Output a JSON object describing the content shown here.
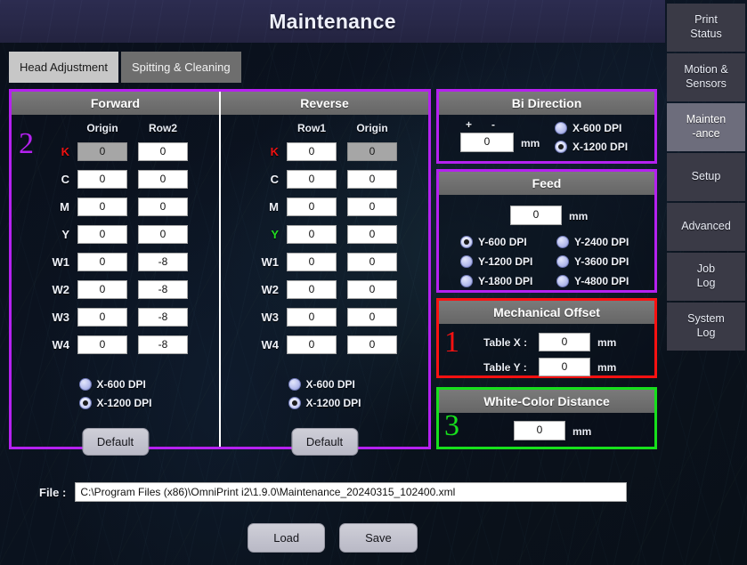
{
  "header": {
    "title": "Maintenance"
  },
  "tabs": [
    {
      "label": "Head Adjustment",
      "active": true
    },
    {
      "label": "Spitting & Cleaning",
      "active": false
    }
  ],
  "annotations": {
    "one": "1",
    "two": "2",
    "three": "3"
  },
  "colors": {
    "accent_magenta": "#b521f0",
    "accent_red": "#fb1111",
    "accent_green": "#17e01c",
    "label_k": "#ee1111",
    "label_y_reverse": "#22dd22",
    "label_default": "#eef1f8",
    "titlebar": "#2a2a4a"
  },
  "head_adjustment": {
    "forward": {
      "title": "Forward",
      "columns": [
        "Origin",
        "Row2"
      ],
      "rows": [
        {
          "label": "K",
          "values": [
            "0",
            "0"
          ],
          "disabled": [
            true,
            false
          ]
        },
        {
          "label": "C",
          "values": [
            "0",
            "0"
          ],
          "disabled": [
            false,
            false
          ]
        },
        {
          "label": "M",
          "values": [
            "0",
            "0"
          ],
          "disabled": [
            false,
            false
          ]
        },
        {
          "label": "Y",
          "values": [
            "0",
            "0"
          ],
          "disabled": [
            false,
            false
          ]
        },
        {
          "label": "W1",
          "values": [
            "0",
            "-8"
          ],
          "disabled": [
            false,
            false
          ]
        },
        {
          "label": "W2",
          "values": [
            "0",
            "-8"
          ],
          "disabled": [
            false,
            false
          ]
        },
        {
          "label": "W3",
          "values": [
            "0",
            "-8"
          ],
          "disabled": [
            false,
            false
          ]
        },
        {
          "label": "W4",
          "values": [
            "0",
            "-8"
          ],
          "disabled": [
            false,
            false
          ]
        }
      ],
      "dpi_options": [
        {
          "label": "X-600 DPI",
          "selected": false
        },
        {
          "label": "X-1200 DPI",
          "selected": true
        }
      ],
      "default_button": "Default"
    },
    "reverse": {
      "title": "Reverse",
      "columns": [
        "Row1",
        "Origin"
      ],
      "rows": [
        {
          "label": "K",
          "values": [
            "0",
            "0"
          ],
          "disabled": [
            false,
            true
          ]
        },
        {
          "label": "C",
          "values": [
            "0",
            "0"
          ],
          "disabled": [
            false,
            false
          ]
        },
        {
          "label": "M",
          "values": [
            "0",
            "0"
          ],
          "disabled": [
            false,
            false
          ]
        },
        {
          "label": "Y",
          "values": [
            "0",
            "0"
          ],
          "disabled": [
            false,
            false
          ]
        },
        {
          "label": "W1",
          "values": [
            "0",
            "0"
          ],
          "disabled": [
            false,
            false
          ]
        },
        {
          "label": "W2",
          "values": [
            "0",
            "0"
          ],
          "disabled": [
            false,
            false
          ]
        },
        {
          "label": "W3",
          "values": [
            "0",
            "0"
          ],
          "disabled": [
            false,
            false
          ]
        },
        {
          "label": "W4",
          "values": [
            "0",
            "0"
          ],
          "disabled": [
            false,
            false
          ]
        }
      ],
      "dpi_options": [
        {
          "label": "X-600 DPI",
          "selected": false
        },
        {
          "label": "X-1200 DPI",
          "selected": true
        }
      ],
      "default_button": "Default"
    }
  },
  "bi_direction": {
    "title": "Bi Direction",
    "plus": "+",
    "minus": "-",
    "value": "0",
    "unit": "mm",
    "dpi_options": [
      {
        "label": "X-600 DPI",
        "selected": false
      },
      {
        "label": "X-1200 DPI",
        "selected": true
      }
    ]
  },
  "feed": {
    "title": "Feed",
    "value": "0",
    "unit": "mm",
    "dpi_options": [
      {
        "label": "Y-600 DPI",
        "selected": true
      },
      {
        "label": "Y-2400 DPI",
        "selected": false
      },
      {
        "label": "Y-1200 DPI",
        "selected": false
      },
      {
        "label": "Y-3600 DPI",
        "selected": false
      },
      {
        "label": "Y-1800 DPI",
        "selected": false
      },
      {
        "label": "Y-4800 DPI",
        "selected": false
      }
    ]
  },
  "mechanical_offset": {
    "title": "Mechanical Offset",
    "fields": [
      {
        "label": "Table X :",
        "value": "0",
        "unit": "mm"
      },
      {
        "label": "Table Y :",
        "value": "0",
        "unit": "mm"
      }
    ]
  },
  "white_color_distance": {
    "title": "White-Color Distance",
    "value": "0",
    "unit": "mm"
  },
  "file": {
    "label": "File :",
    "path": "C:\\Program Files (x86)\\OmniPrint i2\\1.9.0\\Maintenance_20240315_102400.xml"
  },
  "actions": {
    "load": "Load",
    "save": "Save"
  },
  "sidebar": {
    "items": [
      {
        "line1": "Print",
        "line2": "Status",
        "active": false
      },
      {
        "line1": "Motion &",
        "line2": "Sensors",
        "active": false
      },
      {
        "line1": "Mainten",
        "line2": "-ance",
        "active": true
      },
      {
        "line1": "Setup",
        "line2": "",
        "active": false
      },
      {
        "line1": "Advanced",
        "line2": "",
        "active": false
      },
      {
        "line1": "Job",
        "line2": "Log",
        "active": false
      },
      {
        "line1": "System",
        "line2": "Log",
        "active": false
      }
    ]
  }
}
